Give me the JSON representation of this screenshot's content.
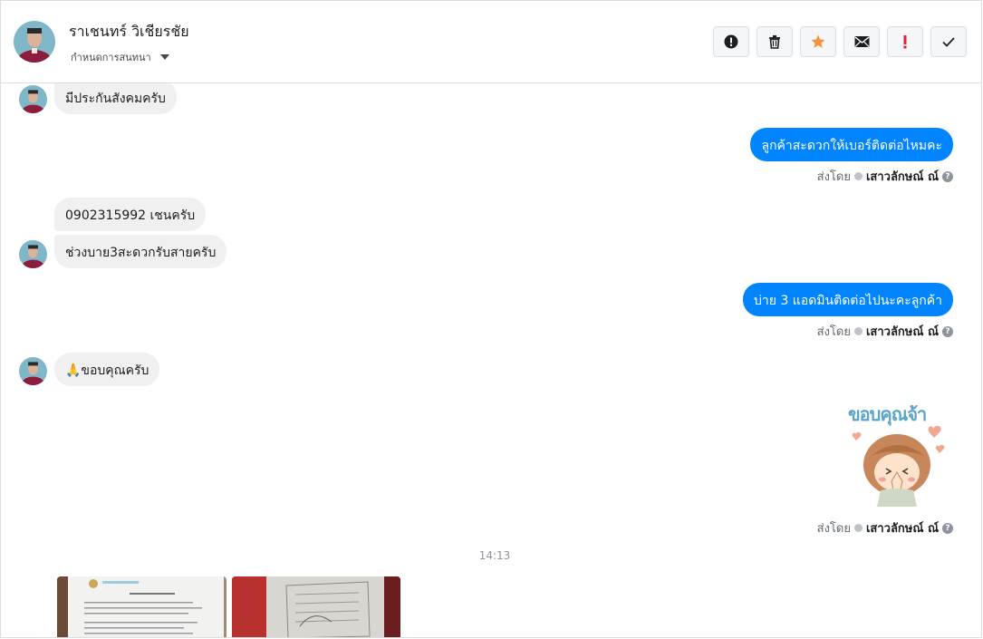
{
  "header": {
    "contact_name": "ราเชนทร์ วิเชียรชัย",
    "conversation_setting": "กำหนดการสนทนา",
    "actions": [
      "report-spam",
      "delete",
      "star",
      "mail",
      "important",
      "done"
    ]
  },
  "messages": {
    "in1": "มีประกันสังคมครับ",
    "out1": "ลูกค้าสะดวกให้เบอร์ติดต่อไหมคะ",
    "in2": "0902315992 เชนครับ",
    "in3": "ช่วงบาย3สะดวกรับสายครับ",
    "out2": "บ่าย 3 แอดมินติดต่อไปนะคะลูกค้า",
    "in4": "🙏ขอบคุณครับ",
    "sticker_text": "ขอบคุณจ้า"
  },
  "sent_by": {
    "prefix": "ส่งโดย",
    "agent": "เสาวลักษณ์ ณ์",
    "help": "?"
  },
  "timestamp": "14:13",
  "colors": {
    "accent_blue": "#0084ff",
    "incoming_bubble": "#f1f0f0",
    "star_orange": "#f7923b",
    "important_red": "#e41e3f"
  }
}
